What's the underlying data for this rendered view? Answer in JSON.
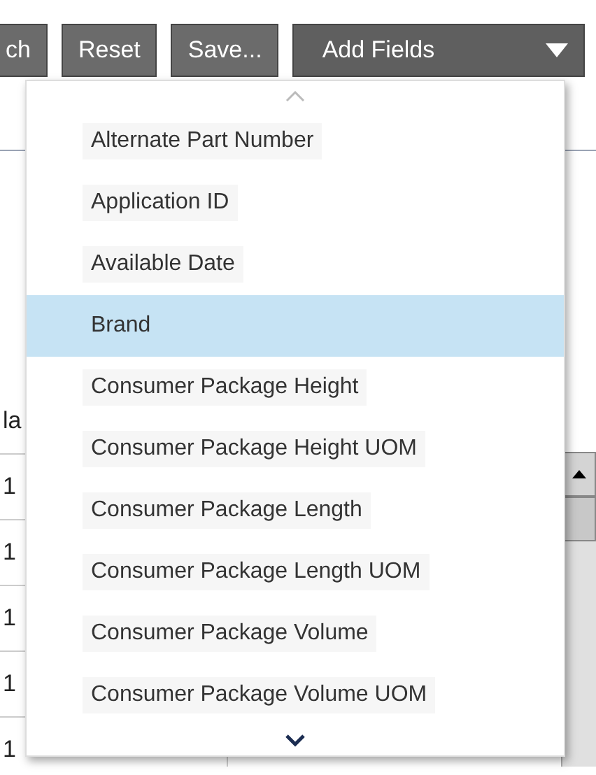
{
  "toolbar": {
    "buttons": [
      {
        "label": "ch"
      },
      {
        "label": "Reset"
      },
      {
        "label": "Save..."
      }
    ],
    "add_fields": {
      "label": "Add Fields",
      "expanded": true
    }
  },
  "table": {
    "header": "la",
    "rows": [
      "1",
      "1",
      "1",
      "1",
      "1"
    ]
  },
  "add_fields_menu": {
    "items": [
      {
        "label": "Alternate Part Number",
        "selected": false
      },
      {
        "label": "Application ID",
        "selected": false
      },
      {
        "label": "Available Date",
        "selected": false
      },
      {
        "label": "Brand",
        "selected": true
      },
      {
        "label": "Consumer Package Height",
        "selected": false
      },
      {
        "label": "Consumer Package Height UOM",
        "selected": false
      },
      {
        "label": "Consumer Package Length",
        "selected": false
      },
      {
        "label": "Consumer Package Length UOM",
        "selected": false
      },
      {
        "label": "Consumer Package Volume",
        "selected": false
      },
      {
        "label": "Consumer Package Volume UOM",
        "selected": false
      }
    ]
  }
}
